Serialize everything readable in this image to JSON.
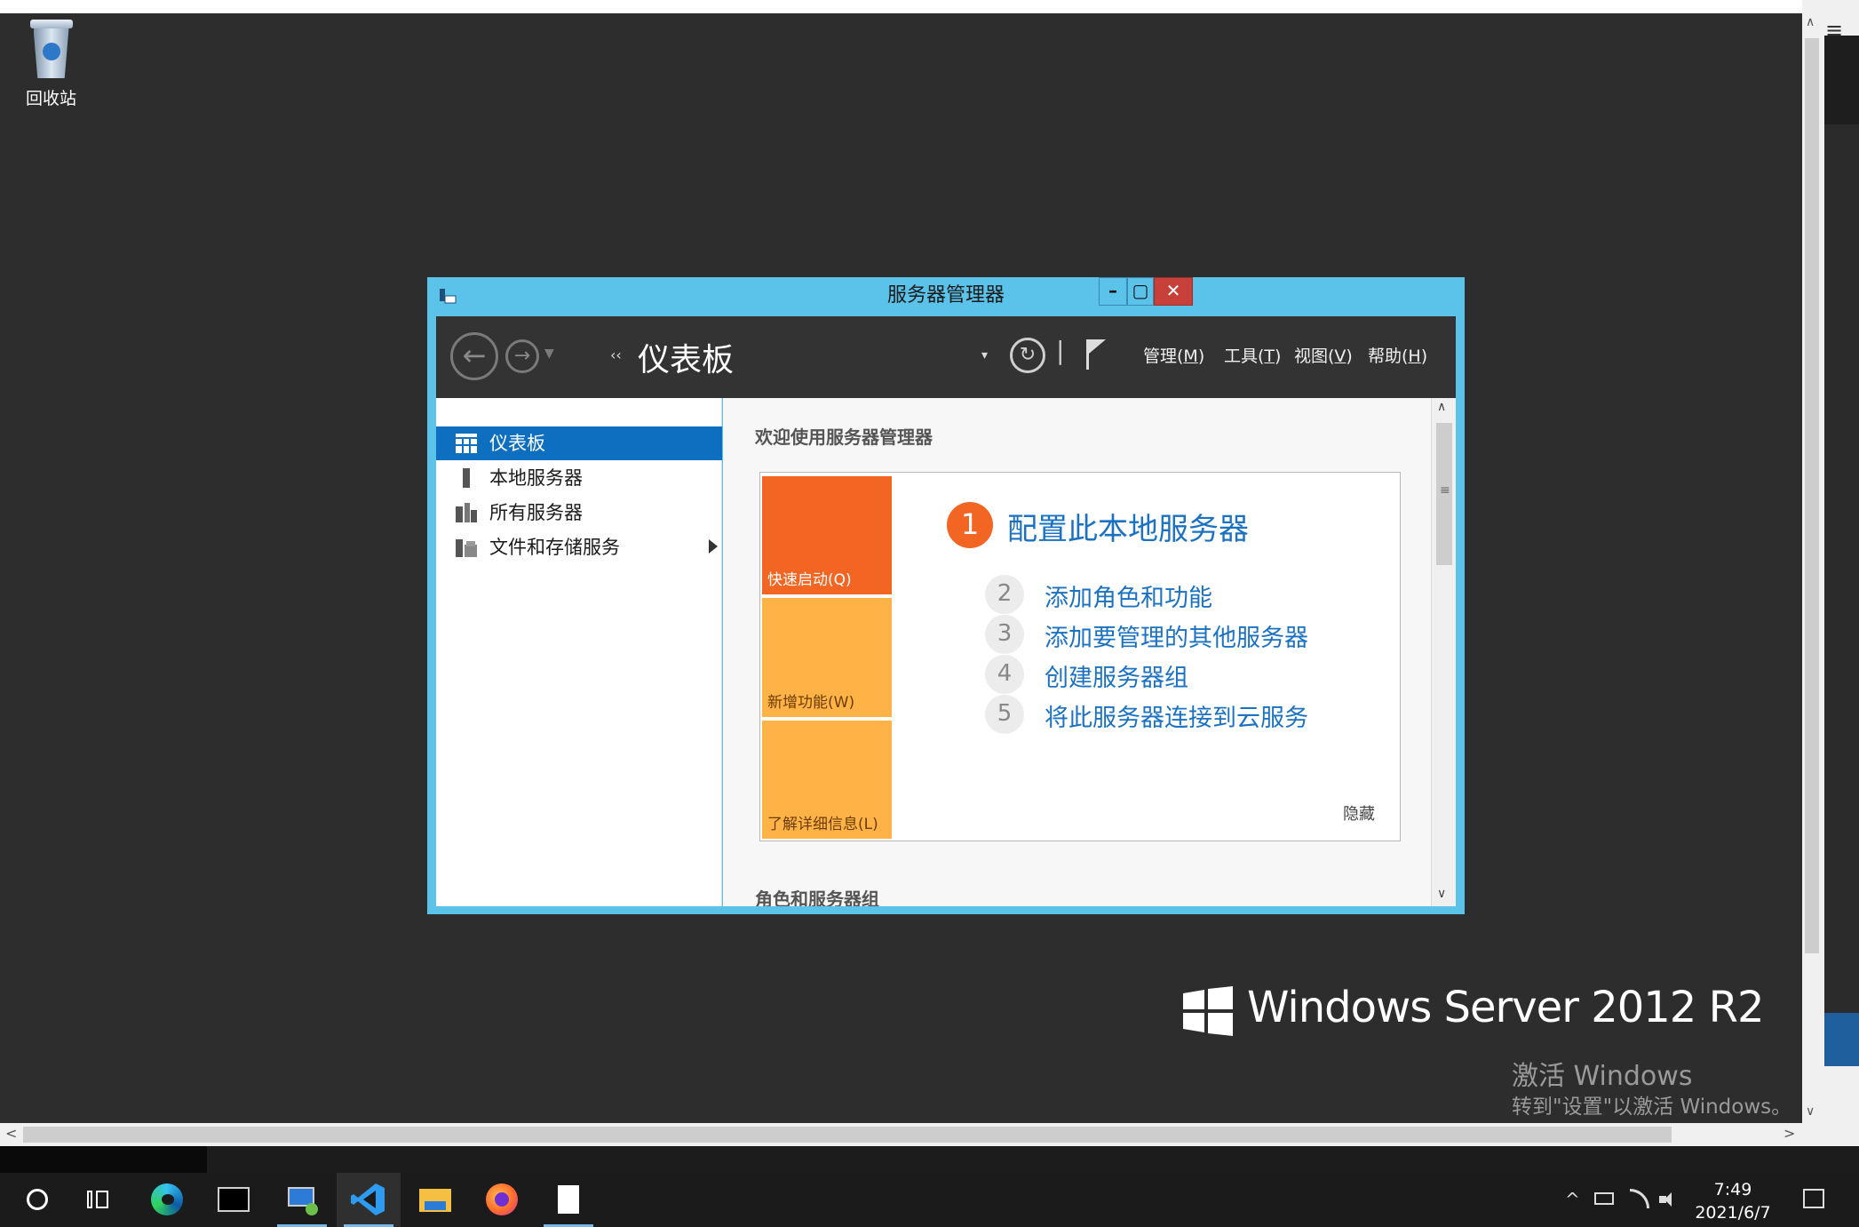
{
  "desktop": {
    "recycle_bin_label": "回收站"
  },
  "window": {
    "title": "服务器管理器",
    "controls": {
      "minimize": "–",
      "maximize": "▢",
      "close": "✕"
    },
    "toolbar": {
      "breadcrumb_arrows": "‹‹",
      "breadcrumb": "仪表板",
      "dropdown": "▾",
      "refresh": "↻",
      "separator": "|",
      "menus": [
        {
          "text": "管理(",
          "key": "M",
          "end": ")"
        },
        {
          "text": "工具(",
          "key": "T",
          "end": ")"
        },
        {
          "text": "视图(",
          "key": "V",
          "end": ")"
        },
        {
          "text": "帮助(",
          "key": "H",
          "end": ")"
        }
      ]
    },
    "nav": [
      {
        "label": "仪表板",
        "selected": true
      },
      {
        "label": "本地服务器",
        "selected": false
      },
      {
        "label": "所有服务器",
        "selected": false
      },
      {
        "label": "文件和存储服务",
        "selected": false
      }
    ],
    "content": {
      "welcome_title": "欢迎使用服务器管理器",
      "tiles": [
        "快速启动(Q)",
        "新增功能(W)",
        "了解详细信息(L)"
      ],
      "step1": {
        "num": "1",
        "text": "配置此本地服务器"
      },
      "steps": [
        {
          "num": "2",
          "text": "添加角色和功能"
        },
        {
          "num": "3",
          "text": "添加要管理的其他服务器"
        },
        {
          "num": "4",
          "text": "创建服务器组"
        },
        {
          "num": "5",
          "text": "将此服务器连接到云服务"
        }
      ],
      "hide": "隐藏",
      "roles_title": "角色和服务器组"
    }
  },
  "watermark": {
    "product": "Windows Server 2012 R2",
    "activate_title": "激活 Windows",
    "activate_hint": "转到\"设置\"以激活 Windows。"
  },
  "scroll_arrows": {
    "up": "∧",
    "down": "∨",
    "left": "<",
    "right": ">",
    "grip": "≡"
  },
  "taskbar": {
    "time": "7:49",
    "date": "2021/6/7",
    "tray_chevron": "^"
  },
  "colors": {
    "window_frame": "#5bc3e9",
    "toolbar": "#333333",
    "nav_selected": "#0e6fc0",
    "quickstart_tile": "#f26522",
    "secondary_tile": "#ffb347",
    "link_blue": "#1b72c2"
  }
}
